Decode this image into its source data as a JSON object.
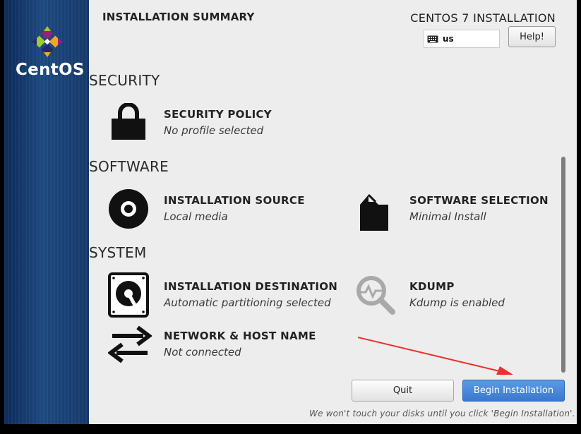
{
  "sidebar": {
    "brand": "CentOS"
  },
  "header": {
    "title": "INSTALLATION SUMMARY",
    "product": "CENTOS 7 INSTALLATION",
    "keyboard_layout": "us",
    "help_label": "Help!"
  },
  "sections": {
    "security": {
      "label": "SECURITY",
      "security_policy": {
        "title": "SECURITY POLICY",
        "status": "No profile selected",
        "icon": "lock-icon"
      }
    },
    "software": {
      "label": "SOFTWARE",
      "installation_source": {
        "title": "INSTALLATION SOURCE",
        "status": "Local media",
        "icon": "disc-icon"
      },
      "software_selection": {
        "title": "SOFTWARE SELECTION",
        "status": "Minimal Install",
        "icon": "package-icon"
      }
    },
    "system": {
      "label": "SYSTEM",
      "installation_destination": {
        "title": "INSTALLATION DESTINATION",
        "status": "Automatic partitioning selected",
        "icon": "hard-disk-icon"
      },
      "kdump": {
        "title": "KDUMP",
        "status": "Kdump is enabled",
        "icon": "magnifier-icon"
      },
      "network": {
        "title": "NETWORK & HOST NAME",
        "status": "Not connected",
        "icon": "network-arrows-icon"
      }
    }
  },
  "footer": {
    "quit_label": "Quit",
    "begin_label": "Begin Installation",
    "note": "We won't touch your disks until you click 'Begin Installation'."
  },
  "colors": {
    "sidebar": "#1e4a82",
    "accent_button": "#3a78cf",
    "annotation_arrow": "#e8322b"
  }
}
